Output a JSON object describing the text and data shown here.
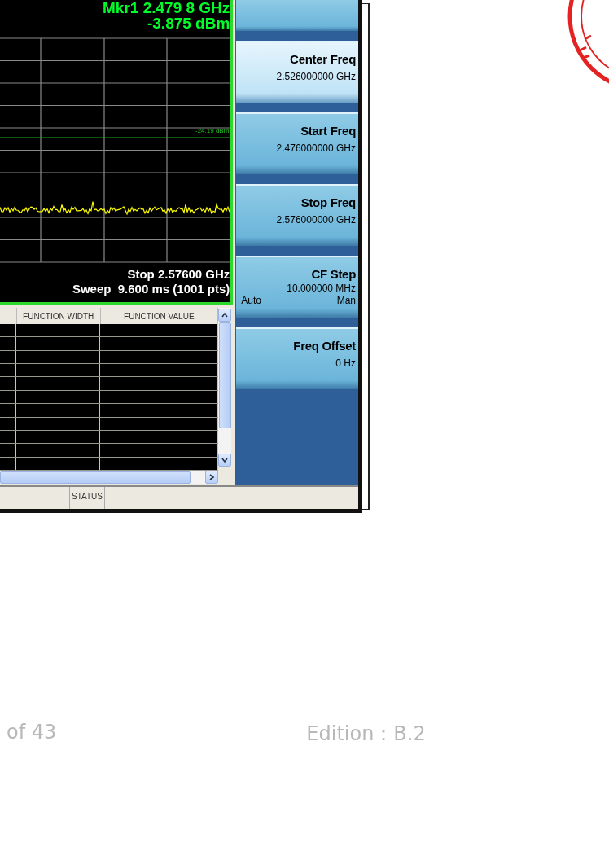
{
  "marker": {
    "label": "Mkr1 2.479 8 GHz",
    "value": "-3.875 dBm"
  },
  "graph": {
    "threshold_label": "-24.19 dBm"
  },
  "sweep_info": {
    "stop": "Stop 2.57600 GHz",
    "sweep": "Sweep  9.600 ms (1001 pts)"
  },
  "table": {
    "columns": [
      "FUNCTION WIDTH",
      "FUNCTION VALUE"
    ]
  },
  "status_bar": {
    "label": "STATUS"
  },
  "softkeys": [
    {
      "kind": "blank",
      "selected": false
    },
    {
      "kind": "value",
      "title": "Center Freq",
      "value": "2.526000000 GHz",
      "selected": true
    },
    {
      "kind": "value",
      "title": "Start Freq",
      "value": "2.476000000 GHz",
      "selected": false
    },
    {
      "kind": "value",
      "title": "Stop Freq",
      "value": "2.576000000 GHz",
      "selected": false
    },
    {
      "kind": "toggle",
      "title": "CF Step",
      "value": "10.000000 MHz",
      "selected": false,
      "options": [
        {
          "label": "Auto",
          "selected": true
        },
        {
          "label": "Man",
          "selected": false
        }
      ]
    },
    {
      "kind": "value",
      "title": "Freq Offset",
      "value": "0 Hz",
      "selected": false
    }
  ],
  "footer": {
    "page": "of 43",
    "edition": "Edition：B.2"
  }
}
